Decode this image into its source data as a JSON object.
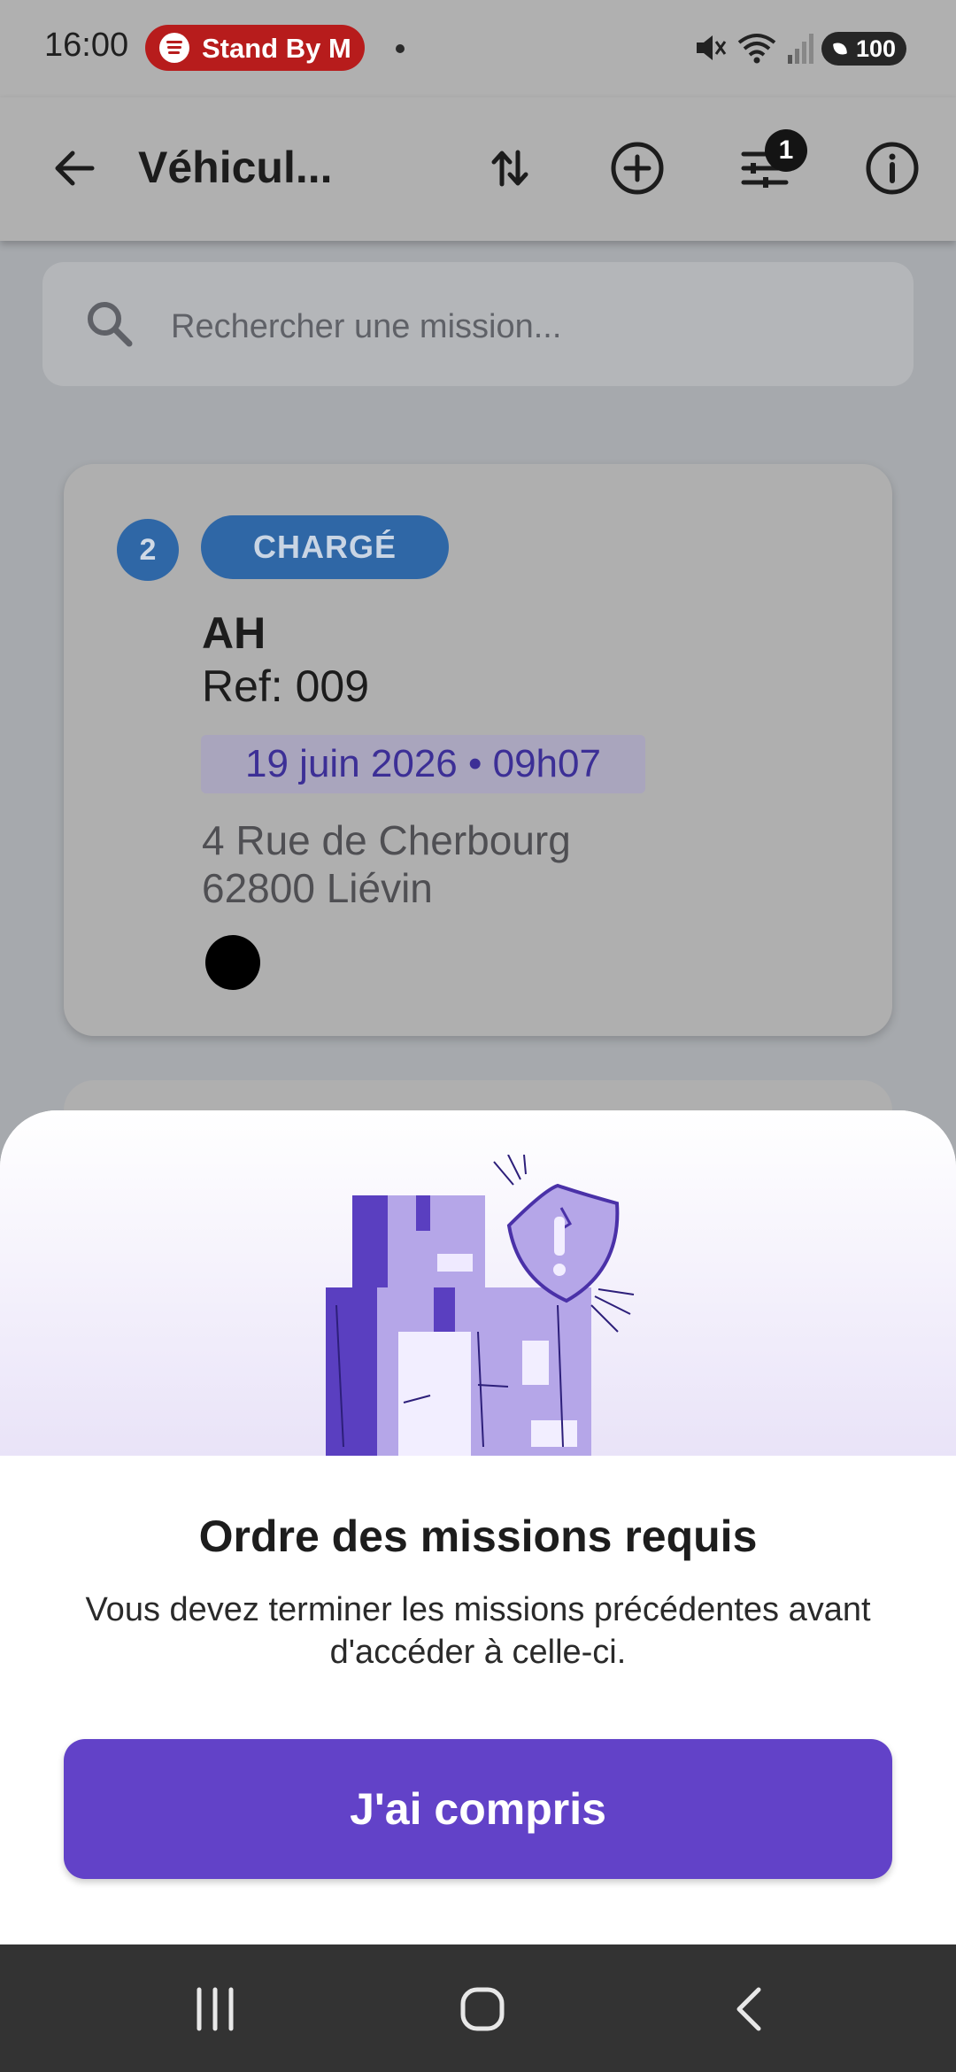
{
  "status_bar": {
    "time": "16:00",
    "media_pill": "Stand By M",
    "battery": "100",
    "icons": [
      "mute-icon",
      "wifi-icon",
      "signal-icon",
      "battery-icon"
    ]
  },
  "app_bar": {
    "title": "Véhicul...",
    "filter_badge": "1",
    "icons": [
      "back-arrow-icon",
      "sort-icon",
      "add-circle-icon",
      "filter-icon",
      "info-icon"
    ]
  },
  "search": {
    "placeholder": "Rechercher une mission..."
  },
  "card": {
    "number": "2",
    "status": "CHARGÉ",
    "title": "AH",
    "ref": "Ref: 009",
    "date": "19 juin 2026 • 09h07",
    "address_line1": "4 Rue de Cherbourg",
    "address_line2": "62800 Liévin"
  },
  "sheet": {
    "title": "Ordre des missions requis",
    "message": "Vous devez terminer les missions précédentes avant d'accéder à celle-ci.",
    "button": "J'ai compris"
  },
  "colors": {
    "accent": "#6242c8",
    "status_badge": "#2f67a6",
    "date_text": "#3c2f96"
  },
  "nav_bar": {
    "icons": [
      "recents-icon",
      "home-icon",
      "back-icon"
    ]
  }
}
